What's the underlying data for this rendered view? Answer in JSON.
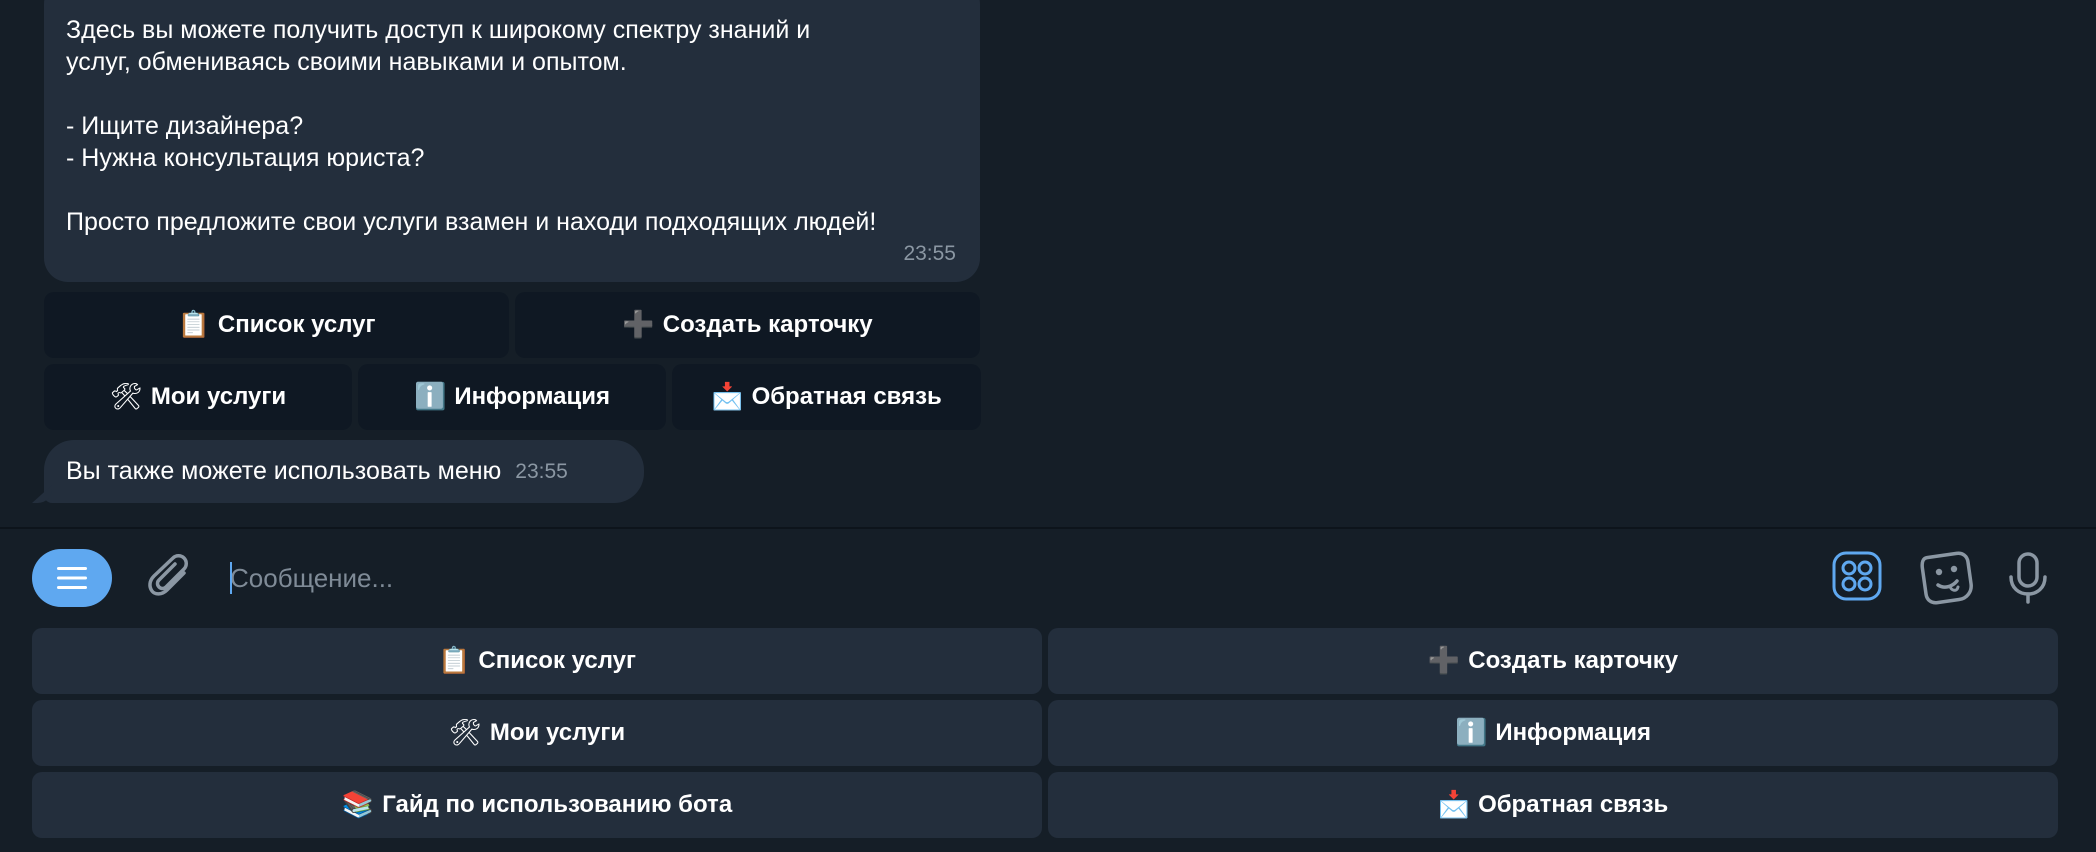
{
  "messages": {
    "main": {
      "text": "Здесь вы можете получить доступ к широкому спектру знаний и\nуслуг, обмениваясь своими навыками и опытом.\n\n- Ищите дизайнера?\n- Нужна консультация юриста?\n\nПросто предложите свои услуги взамен и находи подходящих людей!",
      "time": "23:55"
    },
    "small": {
      "text": "Вы также можете использовать меню",
      "time": "23:55"
    }
  },
  "inline_buttons": {
    "services_list": {
      "emoji": "📋",
      "label": "Список услуг"
    },
    "create_card": {
      "emoji": "➕",
      "label": "Создать карточку"
    },
    "my_services": {
      "emoji": "🛠",
      "label": "Мои услуги"
    },
    "info": {
      "emoji": "ℹ️",
      "label": "Информация"
    },
    "feedback": {
      "emoji": "📩",
      "label": "Обратная связь"
    }
  },
  "input": {
    "placeholder": "Сообщение..."
  },
  "keyboard": {
    "services_list": {
      "emoji": "📋",
      "label": "Список услуг"
    },
    "create_card": {
      "emoji": "➕",
      "label": "Создать карточку"
    },
    "my_services": {
      "emoji": "🛠",
      "label": "Мои услуги"
    },
    "info": {
      "emoji": "ℹ️",
      "label": "Информация"
    },
    "guide": {
      "emoji": "📚",
      "label": "Гайд по использованию бота"
    },
    "feedback": {
      "emoji": "📩",
      "label": "Обратная связь"
    }
  },
  "colors": {
    "accent": "#5fa8f0",
    "bubble": "#232e3c",
    "background": "#151e27"
  },
  "icons": [
    "menu-icon",
    "paperclip-icon",
    "apps-icon",
    "sticker-icon",
    "microphone-icon"
  ]
}
